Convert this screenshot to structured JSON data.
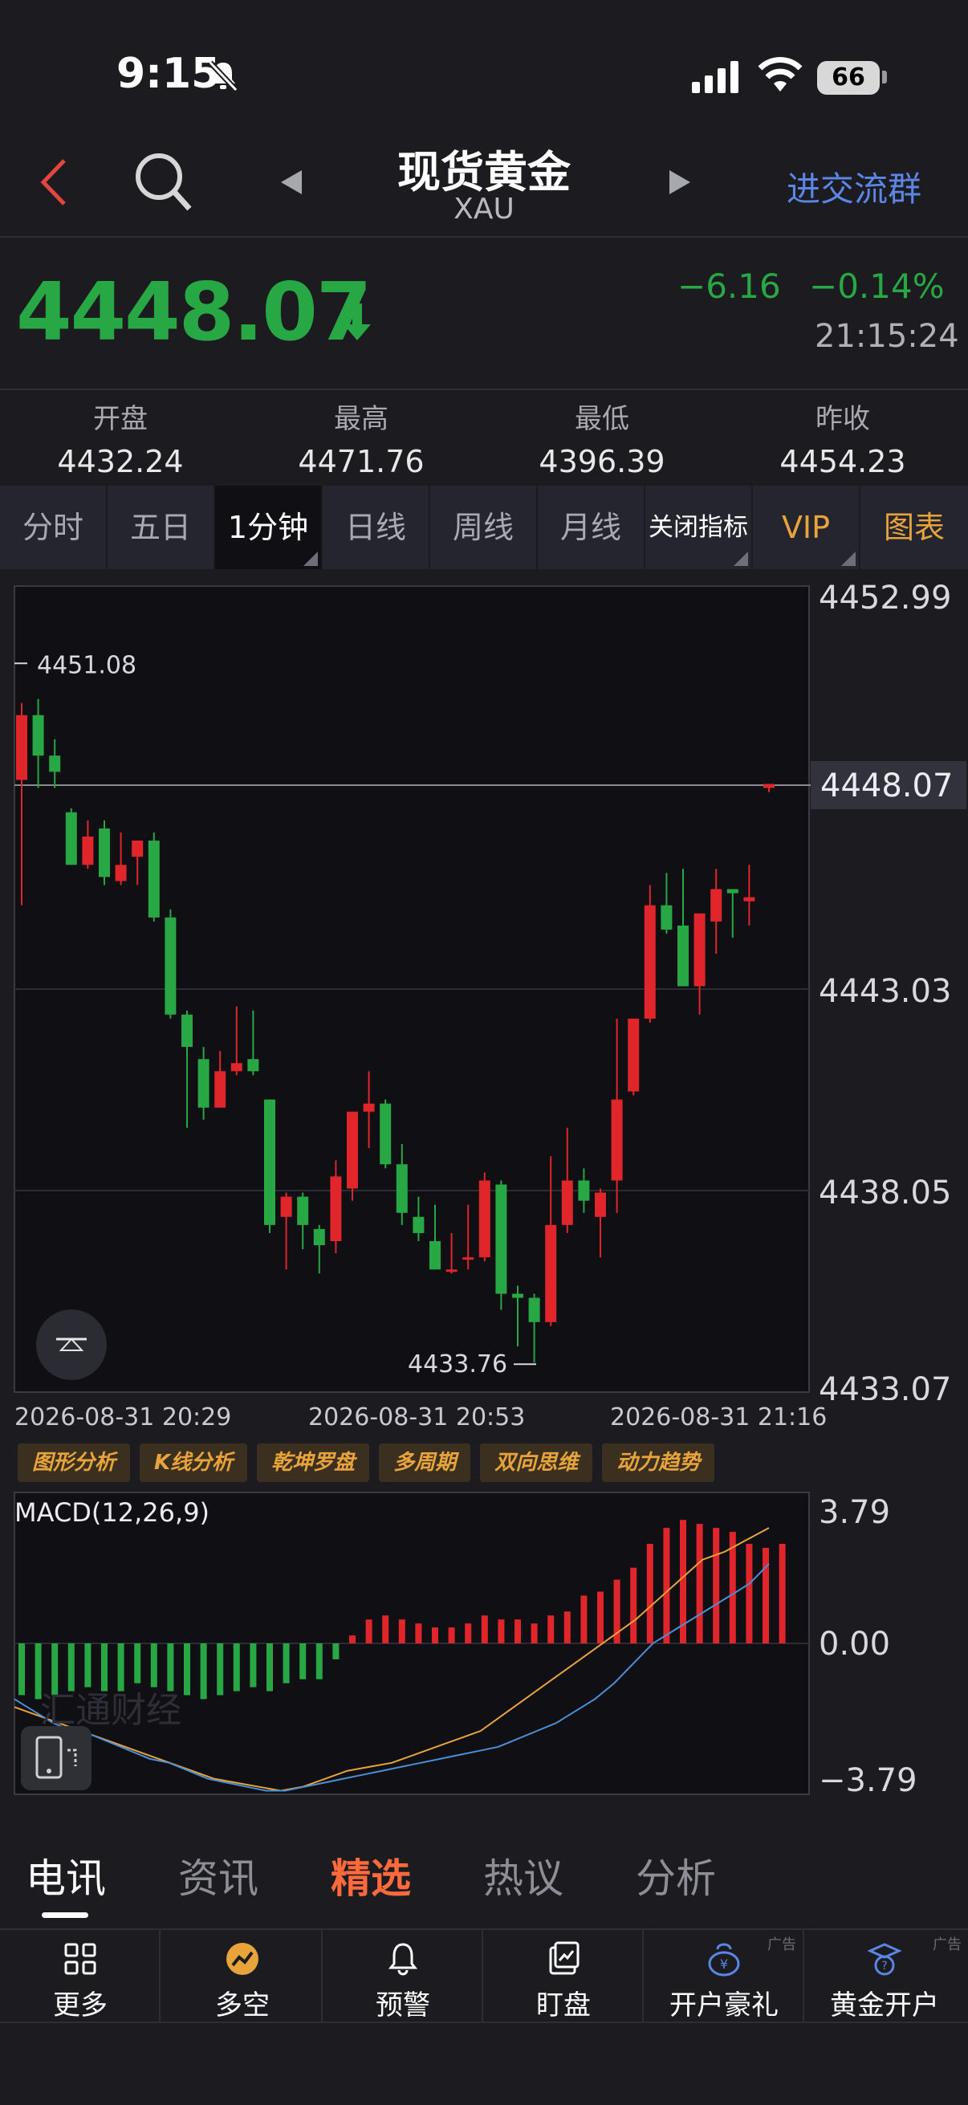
{
  "status_bar": {
    "time": "9:15",
    "battery": "66"
  },
  "header": {
    "title": "现货黄金",
    "subtitle": "XAU",
    "group_link": "进交流群"
  },
  "quote": {
    "price": "4448.07",
    "change": "−6.16",
    "change_pct": "−0.14%",
    "time": "21:15:24",
    "open_label": "开盘",
    "open": "4432.24",
    "high_label": "最高",
    "high": "4471.76",
    "low_label": "最低",
    "low": "4396.39",
    "prev_label": "昨收",
    "prev": "4454.23",
    "down_color": "#27a844",
    "up_color": "#e0262b"
  },
  "period_tabs": [
    "分时",
    "五日",
    "1分钟",
    "日线",
    "周线",
    "月线",
    "关闭指标",
    "VIP",
    "图表"
  ],
  "active_period": "1分钟",
  "chart": {
    "axis_labels": [
      "4452.99",
      "4448.07",
      "4443.03",
      "4438.05",
      "4433.07"
    ],
    "max_label": "4451.08",
    "min_label": "4433.76",
    "dates": [
      "2026-08-31 20:29",
      "2026-08-31 20:53",
      "2026-08-31 21:16"
    ]
  },
  "analysis_tools": [
    "图形分析",
    "K线分析",
    "乾坤罗盘",
    "多周期",
    "双向思维",
    "动力趋势"
  ],
  "macd": {
    "label": "MACD(12,26,9)",
    "axis_labels": [
      "3.79",
      "0.00",
      "−3.79"
    ],
    "watermark": "汇通财经"
  },
  "news_tabs": [
    "电讯",
    "资讯",
    "精选",
    "热议",
    "分析"
  ],
  "toolbar": [
    {
      "label": "更多",
      "icon": "grid-icon",
      "ad": ""
    },
    {
      "label": "多空",
      "icon": "trend-icon",
      "ad": ""
    },
    {
      "label": "预警",
      "icon": "bell-icon",
      "ad": ""
    },
    {
      "label": "盯盘",
      "icon": "monitor-icon",
      "ad": ""
    },
    {
      "label": "开户豪礼",
      "icon": "gift-bag-icon",
      "ad": "广告"
    },
    {
      "label": "黄金开户",
      "icon": "gold-account-icon",
      "ad": "广告"
    }
  ],
  "chart_data": {
    "type": "candlestick",
    "y_range": [
      4433.07,
      4452.99
    ],
    "y_ticks": [
      4452.99,
      4448.07,
      4443.03,
      4438.05,
      4433.07
    ],
    "last_price": 4448.07,
    "max_marker": 4451.08,
    "min_marker": 4433.76,
    "x_ticks": [
      "2026-08-31 20:29",
      "2026-08-31 20:53",
      "2026-08-31 21:16"
    ],
    "candles": [
      {
        "o": 4448.2,
        "h": 4450.1,
        "l": 4445.1,
        "c": 4449.8
      },
      {
        "o": 4449.8,
        "h": 4450.2,
        "l": 4448.0,
        "c": 4448.8
      },
      {
        "o": 4448.8,
        "h": 4449.2,
        "l": 4448.0,
        "c": 4448.4
      },
      {
        "o": 4447.4,
        "h": 4447.5,
        "l": 4446.1,
        "c": 4446.1
      },
      {
        "o": 4446.1,
        "h": 4447.2,
        "l": 4446.0,
        "c": 4446.8
      },
      {
        "o": 4447.0,
        "h": 4447.2,
        "l": 4445.6,
        "c": 4445.8
      },
      {
        "o": 4445.7,
        "h": 4446.9,
        "l": 4445.6,
        "c": 4446.1
      },
      {
        "o": 4446.3,
        "h": 4446.7,
        "l": 4445.6,
        "c": 4446.7
      },
      {
        "o": 4446.7,
        "h": 4446.9,
        "l": 4444.7,
        "c": 4444.8
      },
      {
        "o": 4444.8,
        "h": 4445.0,
        "l": 4442.3,
        "c": 4442.4
      },
      {
        "o": 4442.4,
        "h": 4442.5,
        "l": 4439.6,
        "c": 4441.6
      },
      {
        "o": 4441.3,
        "h": 4441.6,
        "l": 4439.8,
        "c": 4440.1
      },
      {
        "o": 4440.1,
        "h": 4441.5,
        "l": 4440.1,
        "c": 4441.0
      },
      {
        "o": 4441.0,
        "h": 4442.6,
        "l": 4440.9,
        "c": 4441.2
      },
      {
        "o": 4441.3,
        "h": 4442.5,
        "l": 4440.9,
        "c": 4441.0
      },
      {
        "o": 4440.3,
        "h": 4440.3,
        "l": 4437.0,
        "c": 4437.2
      },
      {
        "o": 4437.4,
        "h": 4438.0,
        "l": 4436.1,
        "c": 4437.9
      },
      {
        "o": 4437.9,
        "h": 4438.0,
        "l": 4436.6,
        "c": 4437.2
      },
      {
        "o": 4437.1,
        "h": 4437.2,
        "l": 4436.0,
        "c": 4436.7
      },
      {
        "o": 4436.8,
        "h": 4438.8,
        "l": 4436.5,
        "c": 4438.4
      },
      {
        "o": 4438.1,
        "h": 4440.0,
        "l": 4437.8,
        "c": 4440.0
      },
      {
        "o": 4440.0,
        "h": 4441.0,
        "l": 4439.1,
        "c": 4440.2
      },
      {
        "o": 4440.2,
        "h": 4440.3,
        "l": 4438.6,
        "c": 4438.7
      },
      {
        "o": 4438.7,
        "h": 4439.2,
        "l": 4437.2,
        "c": 4437.5
      },
      {
        "o": 4437.4,
        "h": 4437.9,
        "l": 4436.8,
        "c": 4437.0
      },
      {
        "o": 4436.8,
        "h": 4437.7,
        "l": 4436.1,
        "c": 4436.1
      },
      {
        "o": 4436.1,
        "h": 4437.0,
        "l": 4436.0,
        "c": 4436.1
      },
      {
        "o": 4436.4,
        "h": 4437.7,
        "l": 4436.1,
        "c": 4436.4
      },
      {
        "o": 4436.4,
        "h": 4438.5,
        "l": 4436.3,
        "c": 4438.3
      },
      {
        "o": 4438.2,
        "h": 4438.3,
        "l": 4435.1,
        "c": 4435.5
      },
      {
        "o": 4435.5,
        "h": 4435.7,
        "l": 4434.2,
        "c": 4435.4
      },
      {
        "o": 4435.4,
        "h": 4435.5,
        "l": 4433.8,
        "c": 4434.8
      },
      {
        "o": 4434.8,
        "h": 4438.9,
        "l": 4434.7,
        "c": 4437.2
      },
      {
        "o": 4437.2,
        "h": 4439.6,
        "l": 4437.0,
        "c": 4438.3
      },
      {
        "o": 4438.3,
        "h": 4438.6,
        "l": 4437.5,
        "c": 4437.8
      },
      {
        "o": 4437.4,
        "h": 4438.1,
        "l": 4436.4,
        "c": 4438.0
      },
      {
        "o": 4438.3,
        "h": 4442.3,
        "l": 4437.5,
        "c": 4440.3
      },
      {
        "o": 4440.5,
        "h": 4442.3,
        "l": 4440.4,
        "c": 4442.3
      },
      {
        "o": 4442.3,
        "h": 4445.6,
        "l": 4442.2,
        "c": 4445.1
      },
      {
        "o": 4445.1,
        "h": 4445.9,
        "l": 4444.4,
        "c": 4444.5
      },
      {
        "o": 4444.6,
        "h": 4446.0,
        "l": 4443.1,
        "c": 4443.1
      },
      {
        "o": 4443.1,
        "h": 4444.5,
        "l": 4442.4,
        "c": 4444.9
      },
      {
        "o": 4444.7,
        "h": 4446.0,
        "l": 4443.9,
        "c": 4445.5
      },
      {
        "o": 4445.5,
        "h": 4445.5,
        "l": 4444.3,
        "c": 4445.4
      },
      {
        "o": 4445.2,
        "h": 4446.1,
        "l": 4444.6,
        "c": 4445.3
      },
      {
        "o": 4448.0,
        "h": 4448.1,
        "l": 4447.9,
        "c": 4448.1
      }
    ],
    "macd_range": [
      -3.79,
      3.79
    ],
    "macd_ticks": [
      3.79,
      0.0,
      -3.79
    ],
    "macd_hist": [
      -1.3,
      -1.4,
      -1.3,
      -1.2,
      -1.1,
      -1.2,
      -1.2,
      -1.0,
      -1.1,
      -1.2,
      -1.3,
      -1.4,
      -1.3,
      -1.2,
      -1.1,
      -1.2,
      -1.0,
      -0.9,
      -0.9,
      -0.4,
      0.2,
      0.6,
      0.7,
      0.6,
      0.5,
      0.4,
      0.4,
      0.5,
      0.7,
      0.6,
      0.6,
      0.5,
      0.7,
      0.8,
      1.2,
      1.3,
      1.6,
      1.9,
      2.5,
      2.9,
      3.1,
      3.0,
      2.9,
      2.8,
      2.5,
      2.4,
      2.5
    ],
    "macd_line": [
      -1.4,
      -1.7,
      -2.0,
      -2.2,
      -2.3,
      -2.5,
      -2.7,
      -2.9,
      -3.0,
      -3.2,
      -3.4,
      -3.5,
      -3.6,
      -3.7,
      -3.7,
      -3.6,
      -3.5,
      -3.4,
      -3.3,
      -3.2,
      -3.1,
      -3.0,
      -2.9,
      -2.8,
      -2.7,
      -2.6,
      -2.4,
      -2.2,
      -2.0,
      -1.7,
      -1.4,
      -1.0,
      -0.5,
      0.0,
      0.3,
      0.6,
      0.9,
      1.2,
      1.5,
      2.0
    ],
    "signal_line": [
      -1.6,
      -1.8,
      -2.0,
      -2.2,
      -2.4,
      -2.6,
      -2.8,
      -3.0,
      -3.2,
      -3.4,
      -3.5,
      -3.6,
      -3.7,
      -3.6,
      -3.4,
      -3.2,
      -3.1,
      -3.0,
      -2.8,
      -2.6,
      -2.4,
      -2.2,
      -1.8,
      -1.4,
      -1.0,
      -0.6,
      -0.2,
      0.2,
      0.6,
      1.1,
      1.6,
      2.1,
      2.3,
      2.6,
      2.9
    ]
  }
}
